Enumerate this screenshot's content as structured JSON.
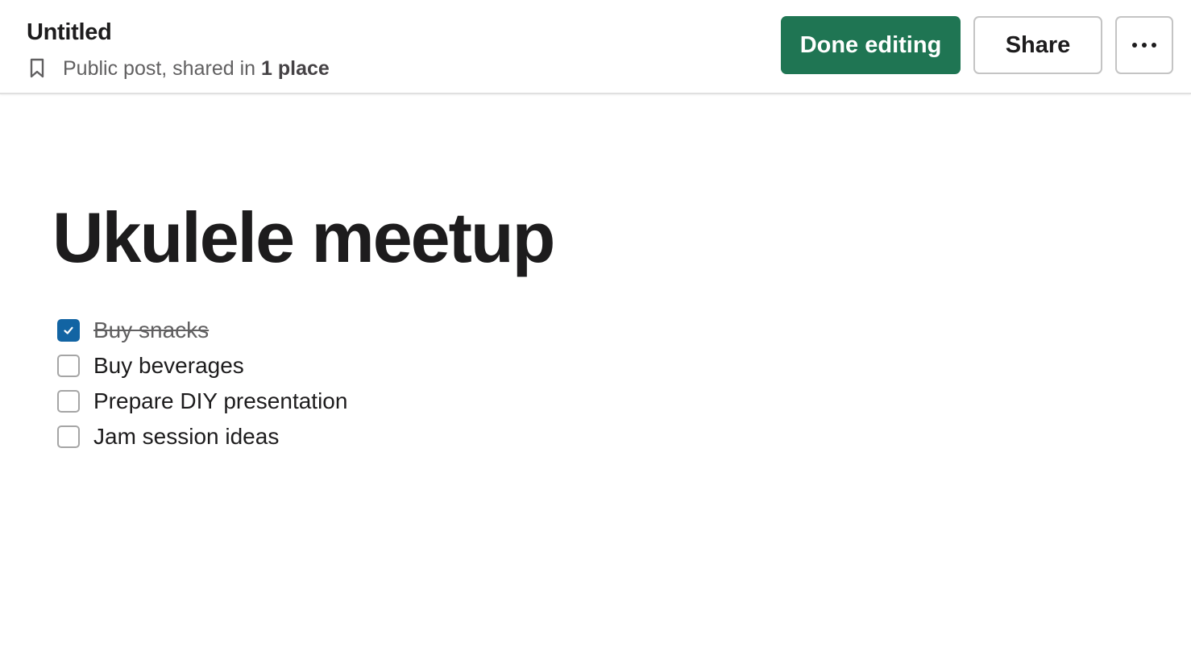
{
  "header": {
    "title": "Untitled",
    "meta_text": "Public post, shared in",
    "meta_strong": "1 place",
    "icon": "bookmark-icon"
  },
  "toolbar": {
    "done_label": "Done editing",
    "share_label": "Share",
    "more_icon": "more-icon"
  },
  "colors": {
    "done_button": "#1f7553",
    "checkbox_checked": "#1264a3"
  },
  "document": {
    "heading": "Ukulele meetup",
    "checklist": [
      {
        "label": "Buy snacks",
        "checked": true
      },
      {
        "label": "Buy beverages",
        "checked": false
      },
      {
        "label": "Prepare DIY presentation",
        "checked": false
      },
      {
        "label": "Jam session ideas",
        "checked": false
      }
    ]
  }
}
